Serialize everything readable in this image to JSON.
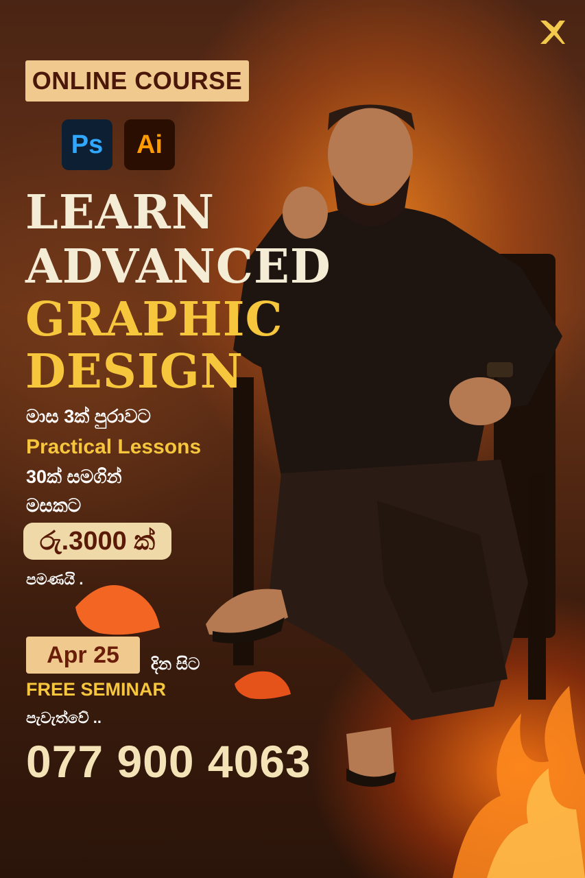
{
  "brand_logo_icon": "x-logo-icon",
  "badge": {
    "label": "ONLINE COURSE"
  },
  "apps": [
    {
      "label": "Ps",
      "icon": "photoshop-icon",
      "color": "#31a8ff"
    },
    {
      "label": "Ai",
      "icon": "illustrator-icon",
      "color": "#ff9a00"
    }
  ],
  "headline": {
    "line1": "LEARN",
    "line2": "ADVANCED",
    "line3": "GRAPHIC",
    "line4": "DESIGN"
  },
  "details": {
    "duration": "මාස 3ක් පුරාවට",
    "practical": "Practical Lessons",
    "lessons": "30ක් සමගින්",
    "monthly": "මසකට",
    "price": "රු.3000 ක්",
    "only": "පමණයි ."
  },
  "seminar": {
    "date": "Apr 25",
    "from": "දින සිට",
    "label": "FREE SEMINAR",
    "held": "පැවැත්වේ .."
  },
  "contact": {
    "phone": "077 900 4063"
  },
  "colors": {
    "accent_yellow": "#f6c63c",
    "cream": "#f5ecd6",
    "badge_bg": "#f0c98f"
  }
}
